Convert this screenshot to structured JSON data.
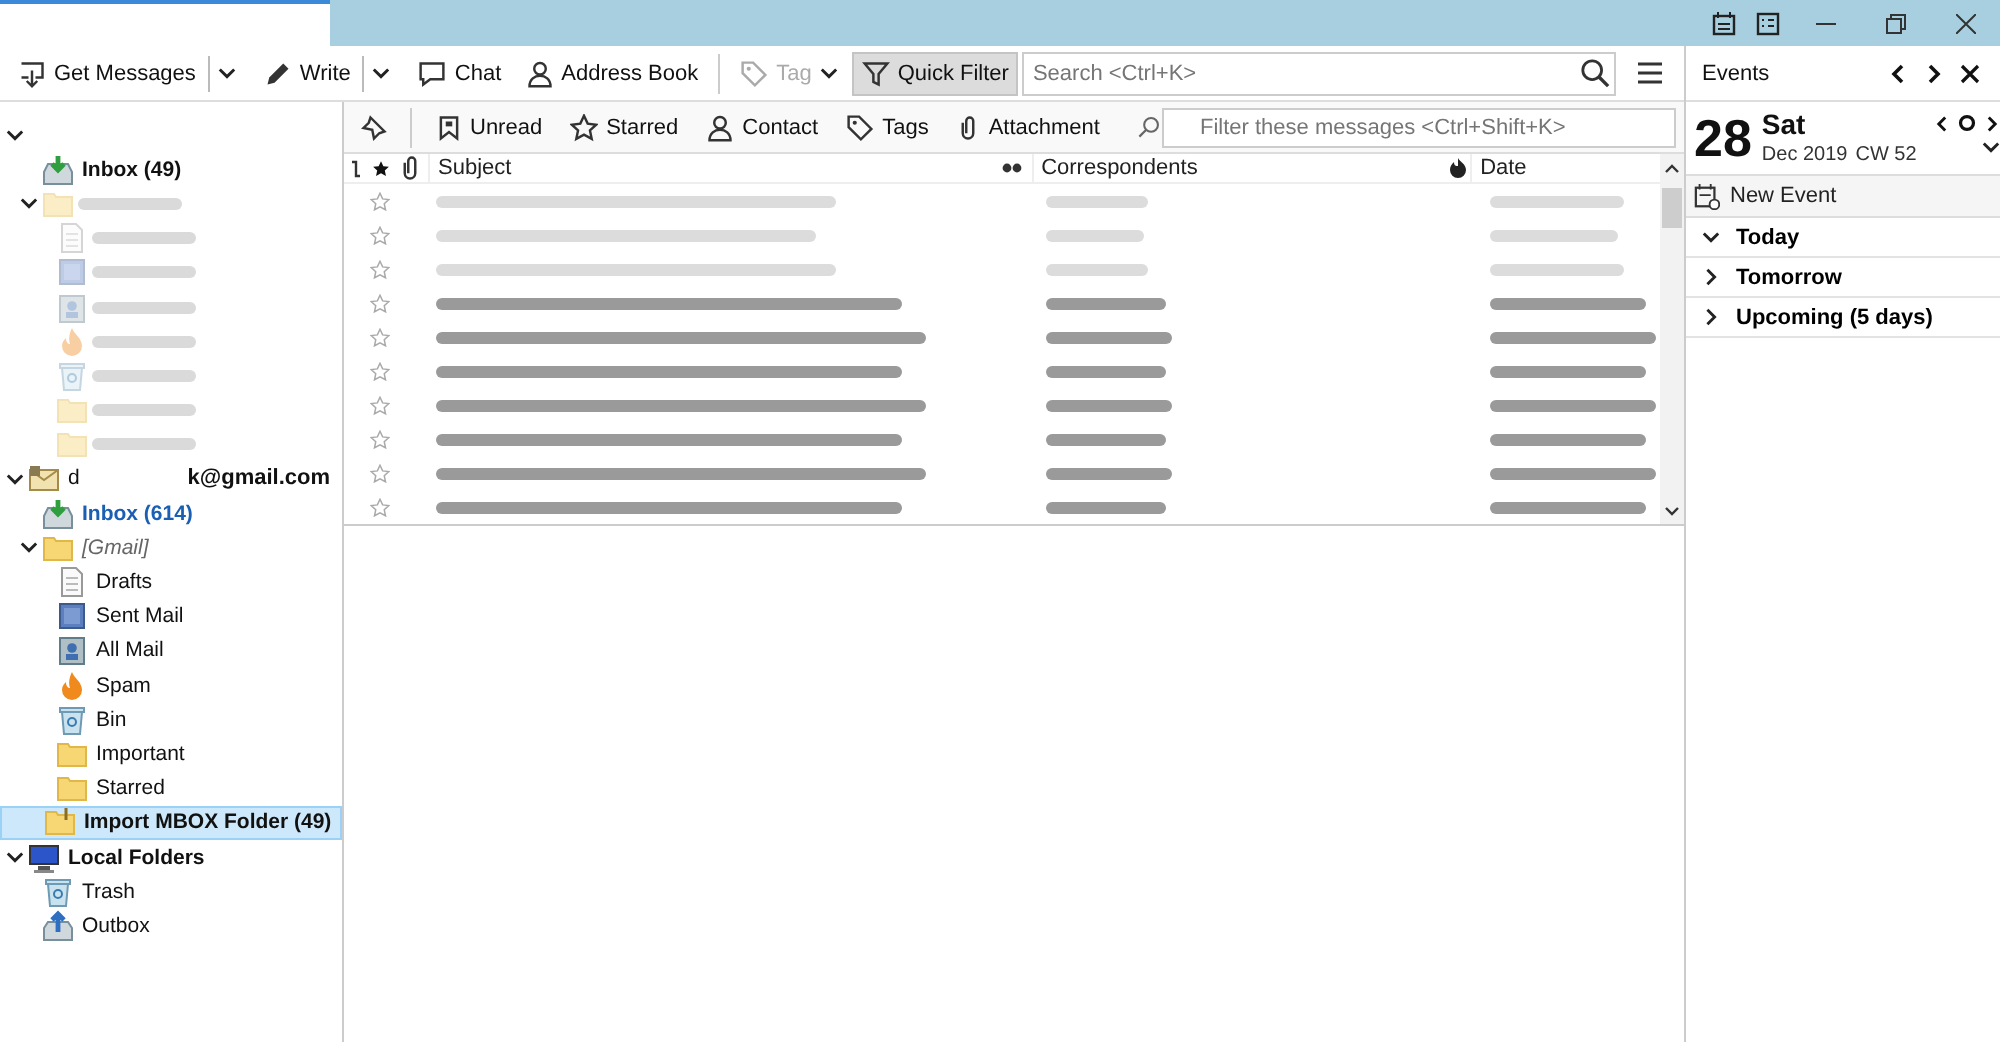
{
  "titlebar": {
    "buttons": [
      {
        "kind": "calendar"
      },
      {
        "kind": "tasks"
      },
      {
        "kind": "minimize"
      },
      {
        "kind": "restore"
      },
      {
        "kind": "close"
      }
    ]
  },
  "toolbar": {
    "items": [
      {
        "kind": "get",
        "label": "Get Messages",
        "dropdown": true,
        "disabled": false,
        "selected": false
      },
      {
        "kind": "write",
        "label": "Write",
        "dropdown": true,
        "disabled": false,
        "selected": false
      },
      {
        "kind": "chat",
        "label": "Chat",
        "dropdown": false,
        "disabled": false,
        "selected": false
      },
      {
        "kind": "contact",
        "label": "Address Book",
        "dropdown": false,
        "disabled": false,
        "selected": false
      },
      {
        "kind": "tag",
        "label": "Tag",
        "dropdown": true,
        "disabled": true,
        "selected": false
      },
      {
        "kind": "filter",
        "label": "Quick Filter",
        "dropdown": false,
        "disabled": false,
        "selected": true
      }
    ],
    "search": {
      "placeholder": "Search <Ctrl+K>"
    }
  },
  "folders": [
    {
      "kind": "blank",
      "expanded": true,
      "selected": false,
      "children": [
        {
          "kind": "inbox",
          "label": "Inbox (49)",
          "bold": true,
          "new_messages": false,
          "selected": false
        },
        {
          "kind": "folder",
          "expanded": true,
          "selected": false,
          "children": [
            {
              "kind": "drafts",
              "selected": false
            },
            {
              "kind": "sent",
              "selected": false
            },
            {
              "kind": "allmail",
              "selected": false
            },
            {
              "kind": "spam",
              "selected": false
            },
            {
              "kind": "trash",
              "selected": false
            },
            {
              "kind": "folder",
              "selected": false
            },
            {
              "kind": "folder",
              "selected": false
            }
          ]
        }
      ]
    },
    {
      "kind": "account",
      "label": "d",
      "email": "k@gmail.com",
      "expanded": true,
      "selected": false,
      "children": [
        {
          "kind": "inbox",
          "label": "Inbox (614)",
          "bold": true,
          "new_messages": true,
          "selected": false
        },
        {
          "kind": "virtual",
          "label": "[Gmail]",
          "expanded": true,
          "selected": false,
          "children": [
            {
              "kind": "drafts",
              "label": "Drafts",
              "selected": false
            },
            {
              "kind": "sent",
              "label": "Sent Mail",
              "selected": false
            },
            {
              "kind": "allmail",
              "label": "All Mail",
              "selected": false
            },
            {
              "kind": "spam",
              "label": "Spam",
              "selected": false
            },
            {
              "kind": "trash",
              "label": "Bin",
              "selected": false
            },
            {
              "kind": "folder",
              "label": "Important",
              "selected": false
            },
            {
              "kind": "folder",
              "label": "Starred",
              "selected": false
            }
          ]
        },
        {
          "kind": "import",
          "label": "Import MBOX Folder (49)",
          "bold": true,
          "selected": true
        }
      ]
    },
    {
      "kind": "local",
      "label": "Local Folders",
      "bold": true,
      "expanded": true,
      "selected": false,
      "children": [
        {
          "kind": "trash",
          "label": "Trash",
          "selected": false
        },
        {
          "kind": "outbox",
          "label": "Outbox",
          "selected": false
        }
      ]
    }
  ],
  "quick_filter": {
    "buttons": [
      {
        "kind": "unread",
        "label": "Unread",
        "selected": false
      },
      {
        "kind": "star",
        "label": "Starred",
        "selected": false
      },
      {
        "kind": "contact",
        "label": "Contact",
        "selected": false
      },
      {
        "kind": "tag",
        "label": "Tags",
        "selected": false
      },
      {
        "kind": "attach",
        "label": "Attachment",
        "selected": false
      }
    ],
    "placeholder": "Filter these messages <Ctrl+Shift+K>"
  },
  "table": {
    "columns": [
      {
        "kind": "thread"
      },
      {
        "kind": "star"
      },
      {
        "kind": "attach"
      },
      {
        "kind": "text",
        "label": "Subject"
      },
      {
        "kind": "read"
      },
      {
        "kind": "text",
        "label": "Correspondents"
      },
      {
        "kind": "junk"
      },
      {
        "kind": "text",
        "label": "Date"
      }
    ],
    "rows": [
      {
        "unread": false,
        "starred": false
      },
      {
        "unread": false,
        "starred": false
      },
      {
        "unread": false,
        "starred": false
      },
      {
        "unread": true,
        "starred": false
      },
      {
        "unread": true,
        "starred": false
      },
      {
        "unread": true,
        "starred": false
      },
      {
        "unread": true,
        "starred": false
      },
      {
        "unread": true,
        "starred": false
      },
      {
        "unread": true,
        "starred": false
      },
      {
        "unread": true,
        "starred": false
      }
    ]
  },
  "events": {
    "title": "Events",
    "day": "28",
    "weekday": "Sat",
    "month_year": "Dec 2019",
    "week": "CW 52",
    "new_event": "New Event",
    "sections": [
      {
        "label": "Today",
        "expanded": true
      },
      {
        "label": "Tomorrow",
        "expanded": false
      },
      {
        "label": "Upcoming (5 days)",
        "expanded": false
      }
    ]
  }
}
